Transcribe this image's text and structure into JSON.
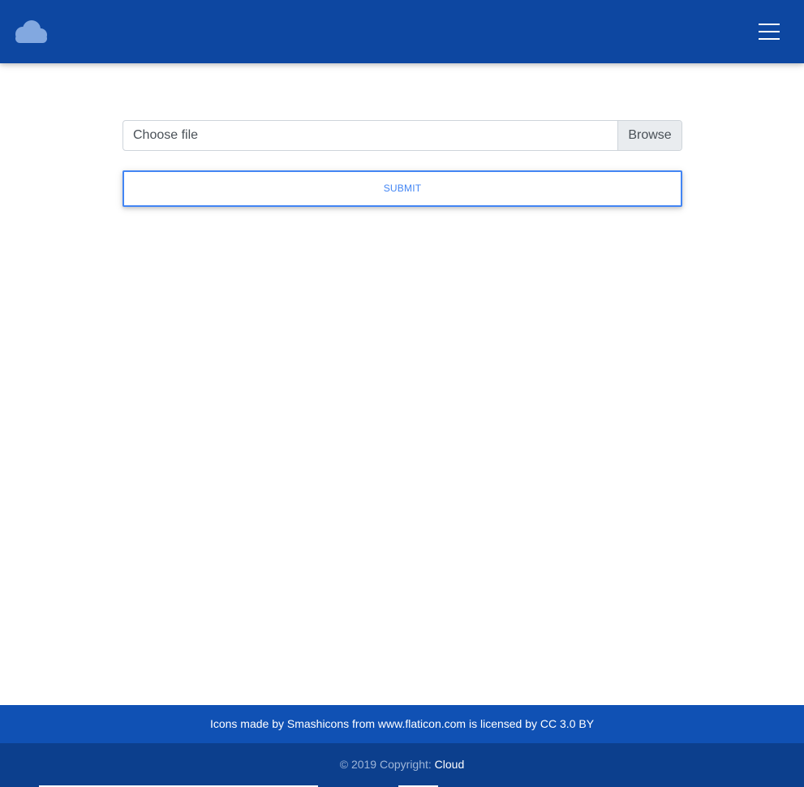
{
  "navbar": {
    "background": "#0d47a1",
    "logo_icon": "cloud-icon",
    "menu_icon": "hamburger-icon"
  },
  "upload": {
    "file_placeholder": "Choose file",
    "browse_label": "Browse",
    "submit_label": "SUBMIT"
  },
  "footer": {
    "credits": {
      "prefix": "Icons made by ",
      "author": "Smashicons",
      "middle": " from ",
      "site": "www.flaticon.com",
      "licensed": " is licensed by ",
      "license": "CC 3.0 BY"
    },
    "copyright_text": "© 2019 Copyright: ",
    "copyright_link": "Cloud"
  },
  "colors": {
    "accent": "#4285f4",
    "footer_top": "#1051b4",
    "footer_bottom": "#0c3f8d"
  }
}
